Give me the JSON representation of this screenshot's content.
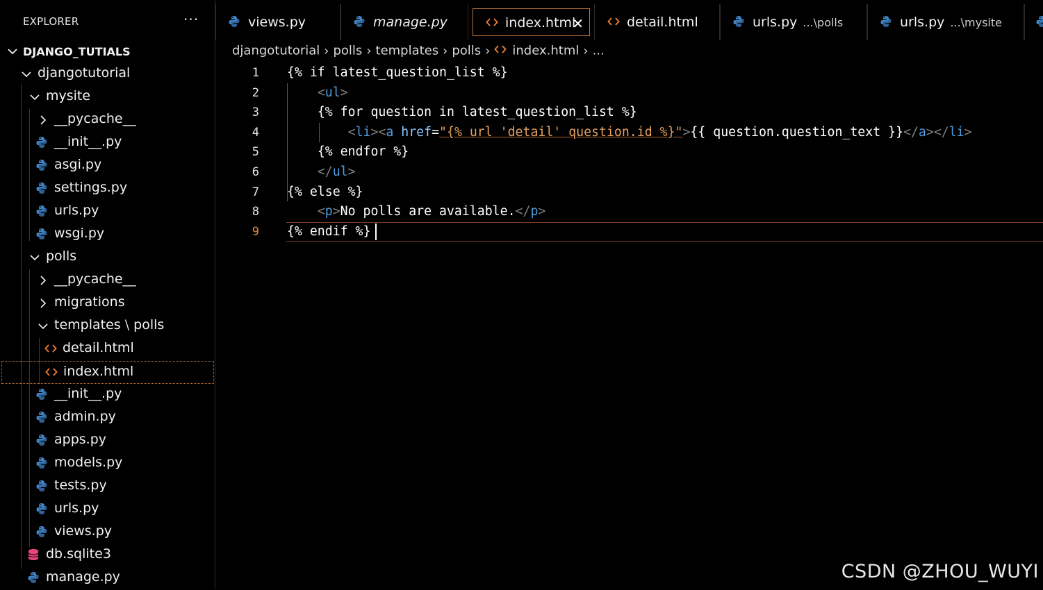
{
  "sidebar": {
    "title": "EXPLORER",
    "more": "···",
    "root": "DJANGO_TUTIALS",
    "tree": [
      {
        "label": "djangotutorial",
        "type": "folder-open"
      },
      {
        "label": "mysite",
        "type": "folder-open"
      },
      {
        "label": "__pycache__",
        "type": "folder-closed"
      },
      {
        "label": "__init__.py",
        "type": "python"
      },
      {
        "label": "asgi.py",
        "type": "python"
      },
      {
        "label": "settings.py",
        "type": "python"
      },
      {
        "label": "urls.py",
        "type": "python"
      },
      {
        "label": "wsgi.py",
        "type": "python"
      },
      {
        "label": "polls",
        "type": "folder-open"
      },
      {
        "label": "__pycache__",
        "type": "folder-closed"
      },
      {
        "label": "migrations",
        "type": "folder-closed"
      },
      {
        "label": "templates",
        "suffix": "polls",
        "type": "folder-open"
      },
      {
        "label": "detail.html",
        "type": "html"
      },
      {
        "label": "index.html",
        "type": "html",
        "selected": true
      },
      {
        "label": "__init__.py",
        "type": "python"
      },
      {
        "label": "admin.py",
        "type": "python"
      },
      {
        "label": "apps.py",
        "type": "python"
      },
      {
        "label": "models.py",
        "type": "python"
      },
      {
        "label": "tests.py",
        "type": "python"
      },
      {
        "label": "urls.py",
        "type": "python"
      },
      {
        "label": "views.py",
        "type": "python"
      },
      {
        "label": "db.sqlite3",
        "type": "database"
      },
      {
        "label": "manage.py",
        "type": "python"
      }
    ]
  },
  "tabs": [
    {
      "label": "views.py",
      "type": "python"
    },
    {
      "label": "manage.py",
      "type": "python",
      "italic": true
    },
    {
      "label": "index.html",
      "type": "html",
      "active": true
    },
    {
      "label": "detail.html",
      "type": "html"
    },
    {
      "label": "urls.py",
      "desc": "...\\polls",
      "type": "python"
    },
    {
      "label": "urls.py",
      "desc": "...\\mysite",
      "type": "python"
    }
  ],
  "breadcrumb": [
    "djangotutorial",
    "polls",
    "templates",
    "polls",
    "index.html",
    "..."
  ],
  "editor": {
    "lines": [
      {
        "n": "1",
        "tokens": [
          [
            "d",
            "{% if latest_question_list %}"
          ]
        ]
      },
      {
        "n": "2",
        "tokens": [
          [
            "s",
            "    "
          ],
          [
            "b",
            "<"
          ],
          [
            "t",
            "ul"
          ],
          [
            "b",
            ">"
          ]
        ]
      },
      {
        "n": "3",
        "tokens": [
          [
            "s",
            "    "
          ],
          [
            "d",
            "{% for question in latest_question_list %}"
          ]
        ]
      },
      {
        "n": "4",
        "tokens": [
          [
            "s",
            "        "
          ],
          [
            "b",
            "<"
          ],
          [
            "t",
            "li"
          ],
          [
            "b",
            "><"
          ],
          [
            "t",
            "a"
          ],
          [
            "s",
            " "
          ],
          [
            "a",
            "href"
          ],
          [
            "d",
            "="
          ],
          [
            "q",
            "\"{% url 'detail' question.id %}\""
          ],
          [
            "b",
            ">"
          ],
          [
            "d",
            "{{ question.question_text }}"
          ],
          [
            "b",
            "</"
          ],
          [
            "t",
            "a"
          ],
          [
            "b",
            "></"
          ],
          [
            "t",
            "li"
          ],
          [
            "b",
            ">"
          ]
        ]
      },
      {
        "n": "5",
        "tokens": [
          [
            "s",
            "    "
          ],
          [
            "d",
            "{% endfor %}"
          ]
        ]
      },
      {
        "n": "6",
        "tokens": [
          [
            "s",
            "    "
          ],
          [
            "b",
            "</"
          ],
          [
            "t",
            "ul"
          ],
          [
            "b",
            ">"
          ]
        ]
      },
      {
        "n": "7",
        "tokens": [
          [
            "d",
            "{% else %}"
          ]
        ]
      },
      {
        "n": "8",
        "tokens": [
          [
            "s",
            "    "
          ],
          [
            "b",
            "<"
          ],
          [
            "t",
            "p"
          ],
          [
            "b",
            ">"
          ],
          [
            "d",
            "No polls are available."
          ],
          [
            "b",
            "</"
          ],
          [
            "t",
            "p"
          ],
          [
            "b",
            ">"
          ]
        ]
      },
      {
        "n": "9",
        "tokens": [
          [
            "d",
            "{% endif %}"
          ]
        ],
        "current": true
      }
    ]
  },
  "watermark": "CSDN @ZHOU_WUYI",
  "colors": {
    "accent": "#c0763b",
    "python_icon": "#3f82c4",
    "html_icon": "#e37933",
    "database_icon": "#e8457a",
    "tag": "#4f9be0",
    "string": "#e4a062"
  }
}
